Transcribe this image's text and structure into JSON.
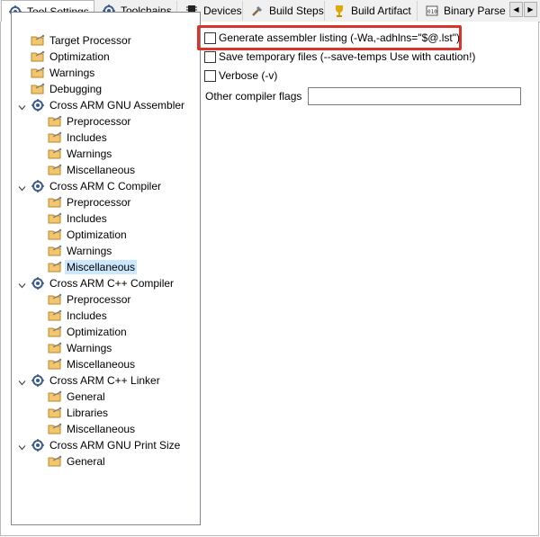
{
  "tabs": [
    {
      "label": "Tool Settings",
      "icon": "tool-settings-icon",
      "active": true
    },
    {
      "label": "Toolchains",
      "icon": "toolchains-icon"
    },
    {
      "label": "Devices",
      "icon": "devices-icon"
    },
    {
      "label": "Build Steps",
      "icon": "build-steps-icon"
    },
    {
      "label": "Build Artifact",
      "icon": "build-artifact-icon"
    },
    {
      "label": "Binary Parsers",
      "icon": "binary-parsers-icon"
    }
  ],
  "tree": [
    {
      "label": "Target Processor",
      "level": 0
    },
    {
      "label": "Optimization",
      "level": 0
    },
    {
      "label": "Warnings",
      "level": 0
    },
    {
      "label": "Debugging",
      "level": 0
    },
    {
      "label": "Cross ARM GNU Assembler",
      "level": 0,
      "tool": true
    },
    {
      "label": "Preprocessor",
      "level": 1
    },
    {
      "label": "Includes",
      "level": 1
    },
    {
      "label": "Warnings",
      "level": 1
    },
    {
      "label": "Miscellaneous",
      "level": 1
    },
    {
      "label": "Cross ARM C Compiler",
      "level": 0,
      "tool": true
    },
    {
      "label": "Preprocessor",
      "level": 1
    },
    {
      "label": "Includes",
      "level": 1
    },
    {
      "label": "Optimization",
      "level": 1
    },
    {
      "label": "Warnings",
      "level": 1
    },
    {
      "label": "Miscellaneous",
      "level": 1,
      "selected": true
    },
    {
      "label": "Cross ARM C++ Compiler",
      "level": 0,
      "tool": true
    },
    {
      "label": "Preprocessor",
      "level": 1
    },
    {
      "label": "Includes",
      "level": 1
    },
    {
      "label": "Optimization",
      "level": 1
    },
    {
      "label": "Warnings",
      "level": 1
    },
    {
      "label": "Miscellaneous",
      "level": 1
    },
    {
      "label": "Cross ARM C++ Linker",
      "level": 0,
      "tool": true
    },
    {
      "label": "General",
      "level": 1
    },
    {
      "label": "Libraries",
      "level": 1
    },
    {
      "label": "Miscellaneous",
      "level": 1
    },
    {
      "label": "Cross ARM GNU Print Size",
      "level": 0,
      "tool": true
    },
    {
      "label": "General",
      "level": 1
    }
  ],
  "options": {
    "generate_listing": {
      "label": "Generate assembler listing (-Wa,-adhlns=\"$@.lst\")",
      "checked": false
    },
    "save_temps": {
      "label": "Save temporary files (--save-temps Use with caution!)",
      "checked": false
    },
    "verbose": {
      "label": "Verbose (-v)",
      "checked": false
    },
    "other_flags": {
      "label": "Other compiler flags",
      "value": ""
    }
  },
  "colors": {
    "highlight": "#d9342b",
    "selected": "#cce8ff",
    "folder": "#e8b14a"
  }
}
